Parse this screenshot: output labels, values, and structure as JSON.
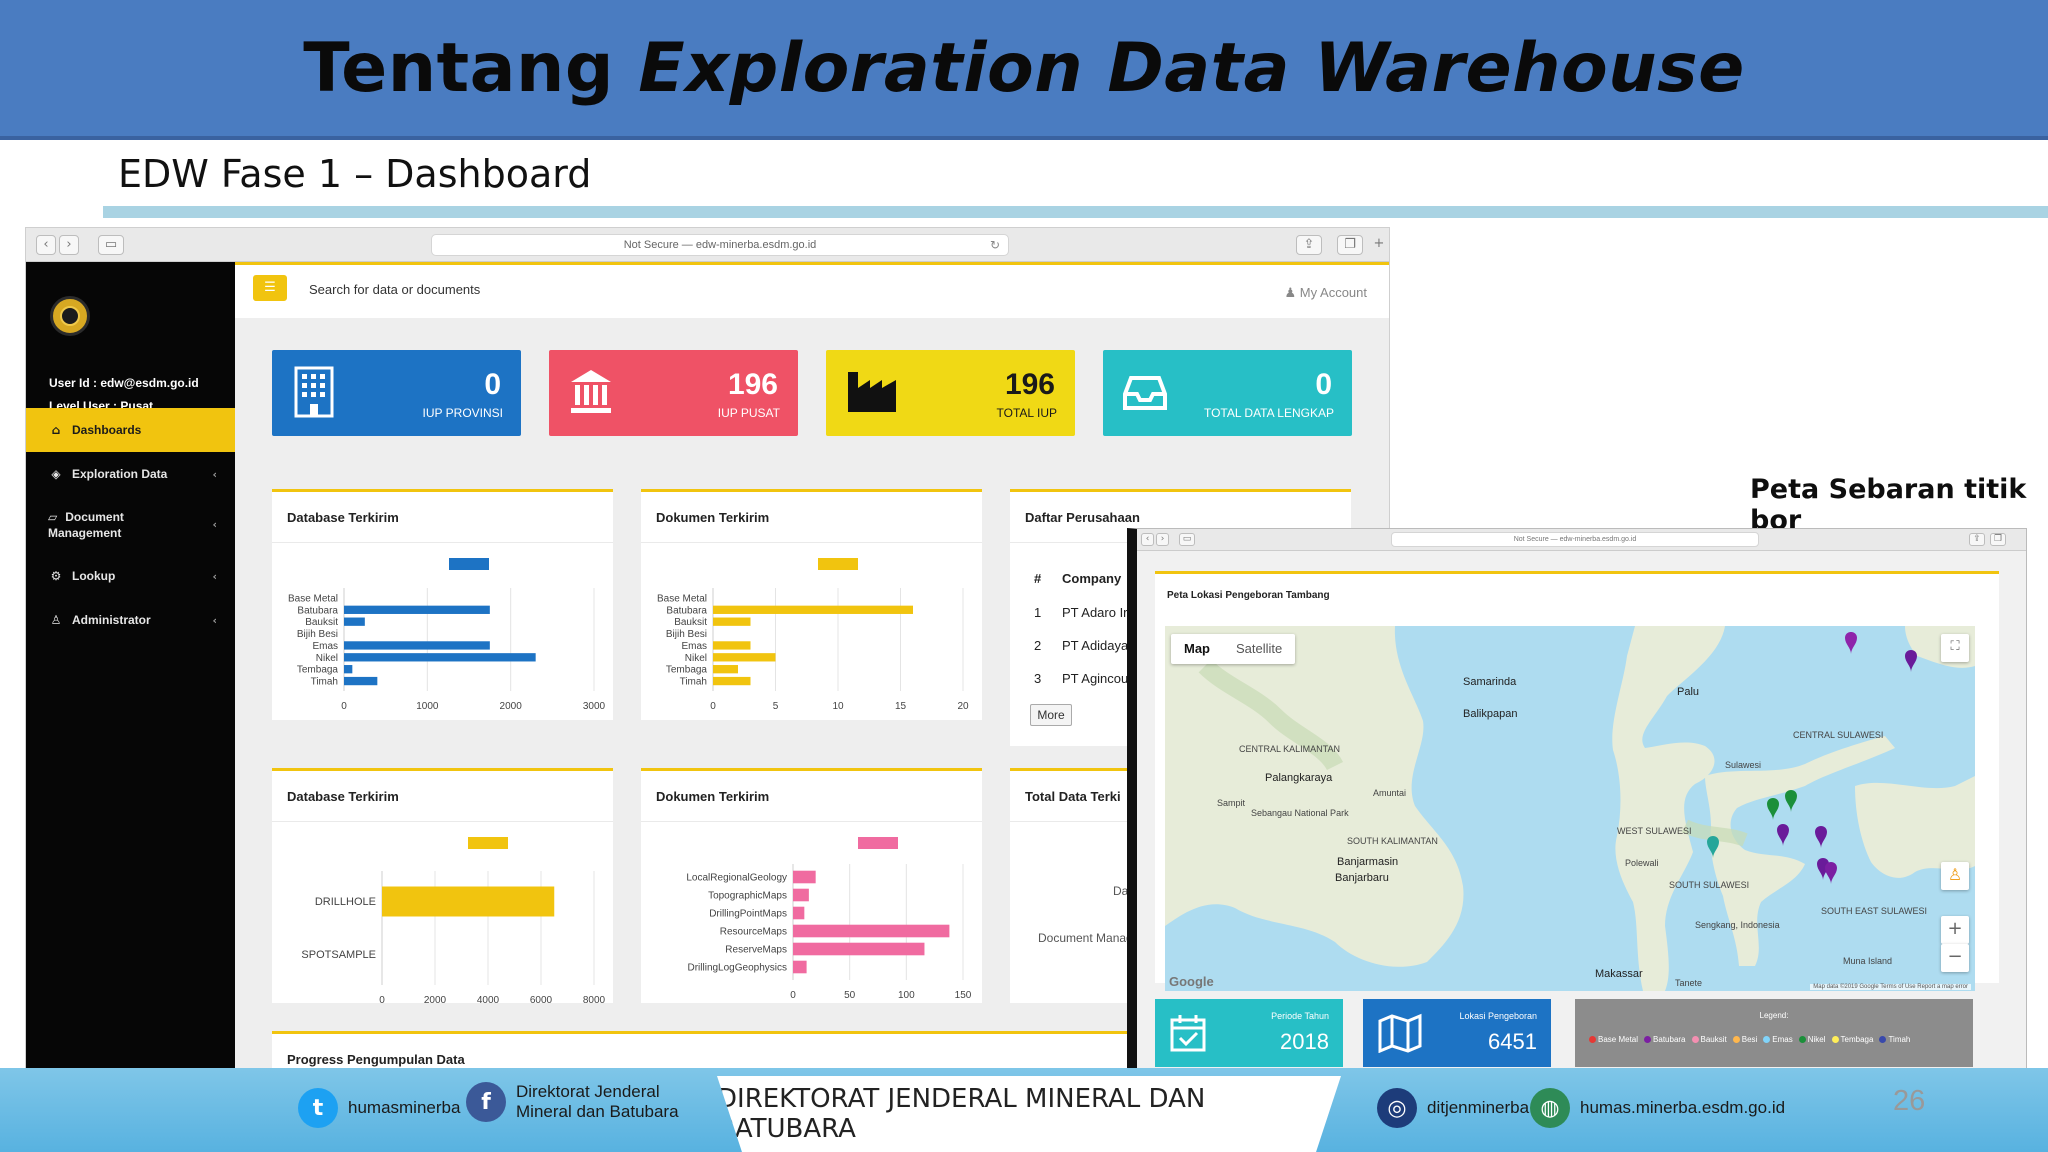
{
  "slide": {
    "title_plain": "Tentang ",
    "title_italic": "Exploration Data Warehouse",
    "subtitle": "EDW Fase 1 – Dashboard",
    "page_number": "26",
    "map_caption": "Peta Sebaran titik bor"
  },
  "browser": {
    "url": "Not Secure — edw-minerba.esdm.go.id",
    "url_small": "Not Secure — edw-minerba.esdm.go.id"
  },
  "sidebar": {
    "user_id": "User Id : edw@esdm.go.id",
    "level": "Level User : Pusat",
    "items": [
      {
        "label": "Dashboards",
        "icon": "home-icon"
      },
      {
        "label": "Exploration Data",
        "icon": "cube-icon"
      },
      {
        "label": "Document",
        "label2": "Management",
        "icon": "folder-icon"
      },
      {
        "label": "Lookup",
        "icon": "gears-icon"
      },
      {
        "label": "Administrator",
        "icon": "user-icon"
      }
    ]
  },
  "topbar": {
    "search_text": "Search for data or documents",
    "account": "My Account"
  },
  "stats": [
    {
      "value": "0",
      "label": "IUP PROVINSI",
      "color": "#1d73c4",
      "icon": "building-icon"
    },
    {
      "value": "196",
      "label": "IUP PUSAT",
      "color": "#ef5266",
      "icon": "bank-icon"
    },
    {
      "value": "196",
      "label": "TOTAL IUP",
      "color": "#f0d915",
      "icon": "factory-icon"
    },
    {
      "value": "0",
      "label": "TOTAL DATA LENGKAP",
      "color": "#27bfc6",
      "icon": "inbox-icon"
    }
  ],
  "panels": {
    "db1_title": "Database Terkirim",
    "doc1_title": "Dokumen Terkirim",
    "company_title": "Daftar Perusahaan",
    "db2_title": "Database Terkirim",
    "doc2_title": "Dokumen Terkirim",
    "total_title": "Total Data Terki",
    "progress_title": "Progress Pengumpulan Data"
  },
  "companies": {
    "header_num": "#",
    "header_name": "Company",
    "rows": [
      {
        "num": "1",
        "name": "PT Adaro Ir"
      },
      {
        "num": "2",
        "name": "PT Adidaya"
      },
      {
        "num": "3",
        "name": "PT Agincou"
      }
    ],
    "more": "More"
  },
  "total_data": {
    "text1": "Da",
    "text2": "Document Manag"
  },
  "chart_data": [
    {
      "type": "bar",
      "orientation": "horizontal",
      "title": "Database Terkirim",
      "categories": [
        "Base Metal",
        "Batubara",
        "Bauksit",
        "Bijih Besi",
        "Emas",
        "Nikel",
        "Tembaga",
        "Timah"
      ],
      "values": [
        0,
        1750,
        250,
        0,
        1750,
        2300,
        100,
        400
      ],
      "xlim": [
        0,
        3000
      ],
      "xticks": [
        "0",
        "1000",
        "2000",
        "3000"
      ],
      "color": "#1d73c4"
    },
    {
      "type": "bar",
      "orientation": "horizontal",
      "title": "Dokumen Terkirim",
      "categories": [
        "Base Metal",
        "Batubara",
        "Bauksit",
        "Bijih Besi",
        "Emas",
        "Nikel",
        "Tembaga",
        "Timah"
      ],
      "values": [
        0,
        16,
        3,
        0,
        3,
        5,
        2,
        3
      ],
      "xlim": [
        0,
        20
      ],
      "xticks": [
        "0",
        "5",
        "10",
        "15",
        "20"
      ],
      "color": "#f1c40f"
    },
    {
      "type": "bar",
      "orientation": "horizontal",
      "title": "Database Terkirim",
      "categories": [
        "DRILLHOLE",
        "SPOTSAMPLE"
      ],
      "values": [
        6500,
        0
      ],
      "xlim": [
        0,
        8000
      ],
      "xticks": [
        "0",
        "2000",
        "4000",
        "6000",
        "8000"
      ],
      "color": "#f1c40f"
    },
    {
      "type": "bar",
      "orientation": "horizontal",
      "title": "Dokumen Terkirim",
      "categories": [
        "LocalRegionalGeology",
        "TopographicMaps",
        "DrillingPointMaps",
        "ResourceMaps",
        "ReserveMaps",
        "DrillingLogGeophysics"
      ],
      "values": [
        20,
        14,
        10,
        138,
        116,
        12
      ],
      "xlim": [
        0,
        150
      ],
      "xticks": [
        "0",
        "50",
        "100",
        "150"
      ],
      "color": "#f06ba0"
    }
  ],
  "map": {
    "panel_title": "Peta Lokasi Pengeboran Tambang",
    "toggle_map": "Map",
    "toggle_satellite": "Satellite",
    "labels": [
      {
        "text": "Samarinda",
        "big": true
      },
      {
        "text": "Balikpapan",
        "big": true
      },
      {
        "text": "Palu",
        "big": true
      },
      {
        "text": "Palangkaraya",
        "big": true
      },
      {
        "text": "Banjarmasin",
        "big": true
      },
      {
        "text": "Banjarbaru",
        "big": true
      },
      {
        "text": "Makassar",
        "big": true
      },
      {
        "text": "CENTRAL KALIMANTAN",
        "big": false
      },
      {
        "text": "SOUTH KALIMANTAN",
        "big": false
      },
      {
        "text": "CENTRAL SULAWESI",
        "big": false
      },
      {
        "text": "WEST SULAWESI",
        "big": false
      },
      {
        "text": "SOUTH SULAWESI",
        "big": false
      },
      {
        "text": "SOUTH EAST SULAWESI",
        "big": false
      },
      {
        "text": "Sulawesi",
        "big": false
      },
      {
        "text": "Sampit",
        "big": false
      },
      {
        "text": "Amuntai",
        "big": false
      },
      {
        "text": "Polewali",
        "big": false
      },
      {
        "text": "Sengkang, Indonesia",
        "big": false
      },
      {
        "text": "Tanete",
        "big": false
      },
      {
        "text": "Muna Island",
        "big": false
      },
      {
        "text": "Sebangau National Park",
        "big": false
      }
    ],
    "google": "Google",
    "footer": "Map data ©2019 Google   Terms of Use   Report a map error"
  },
  "info_cards": [
    {
      "label": "Periode Tahun",
      "value": "2018",
      "color": "#27bfc6",
      "icon": "calendar-icon"
    },
    {
      "label": "Lokasi Pengeboran",
      "value": "6451",
      "color": "#1d73c4",
      "icon": "map-icon"
    }
  ],
  "legend": {
    "title": "Legend:",
    "items": [
      {
        "label": "Base Metal",
        "color": "#e53935"
      },
      {
        "label": "Batubara",
        "color": "#7b1fa2"
      },
      {
        "label": "Bauksit",
        "color": "#f48fb1"
      },
      {
        "label": "Besi",
        "color": "#ffb74d"
      },
      {
        "label": "Emas",
        "color": "#81d4fa"
      },
      {
        "label": "Nikel",
        "color": "#1b8f3a"
      },
      {
        "label": "Tembaga",
        "color": "#ffee58"
      },
      {
        "label": "Timah",
        "color": "#3949ab"
      }
    ]
  },
  "footer": {
    "twitter": "humasminerba",
    "facebook_line1": "Direktorat Jenderal",
    "facebook_line2": "Mineral dan Batubara",
    "main": "DIREKTORAT JENDERAL MINERAL DAN BATUBARA",
    "instagram": "ditjenminerba",
    "web": "humas.minerba.esdm.go.id"
  }
}
